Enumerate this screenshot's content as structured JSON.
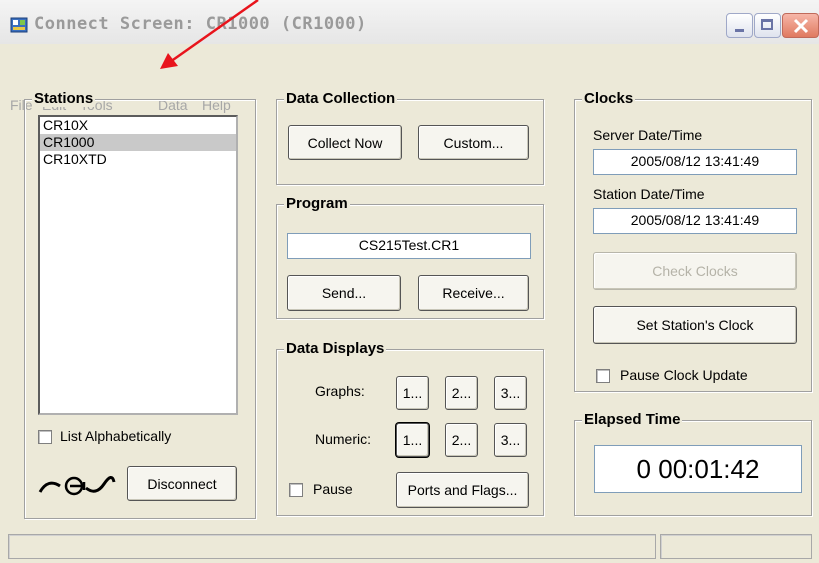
{
  "window": {
    "title": "Connect Screen: CR1000 (CR1000)"
  },
  "menu": [
    "File",
    "Edit",
    "Tools",
    "Data",
    "Help"
  ],
  "stations": {
    "label": "Stations",
    "items": [
      "CR10X",
      "CR1000",
      "CR10XTD"
    ],
    "selected": "CR1000",
    "list_alpha_label": "List Alphabetically",
    "disconnect_label": "Disconnect"
  },
  "data_collection": {
    "label": "Data Collection",
    "collect_now": "Collect Now",
    "custom": "Custom..."
  },
  "program": {
    "label": "Program",
    "filename": "CS215Test.CR1",
    "send": "Send...",
    "receive": "Receive..."
  },
  "data_displays": {
    "label": "Data Displays",
    "graphs_label": "Graphs:",
    "numeric_label": "Numeric:",
    "b1": "1...",
    "b2": "2...",
    "b3": "3...",
    "pause_label": "Pause",
    "ports_flags": "Ports and Flags..."
  },
  "clocks": {
    "label": "Clocks",
    "server_label": "Server Date/Time",
    "server_value": "2005/08/12 13:41:49",
    "station_label": "Station Date/Time",
    "station_value": "2005/08/12 13:41:49",
    "check_clocks": "Check Clocks",
    "set_clock": "Set Station's Clock",
    "pause_update": "Pause Clock Update"
  },
  "elapsed": {
    "label": "Elapsed Time",
    "value": "0 00:01:42"
  },
  "annotation": {
    "arrow_color": "#e8141c"
  }
}
